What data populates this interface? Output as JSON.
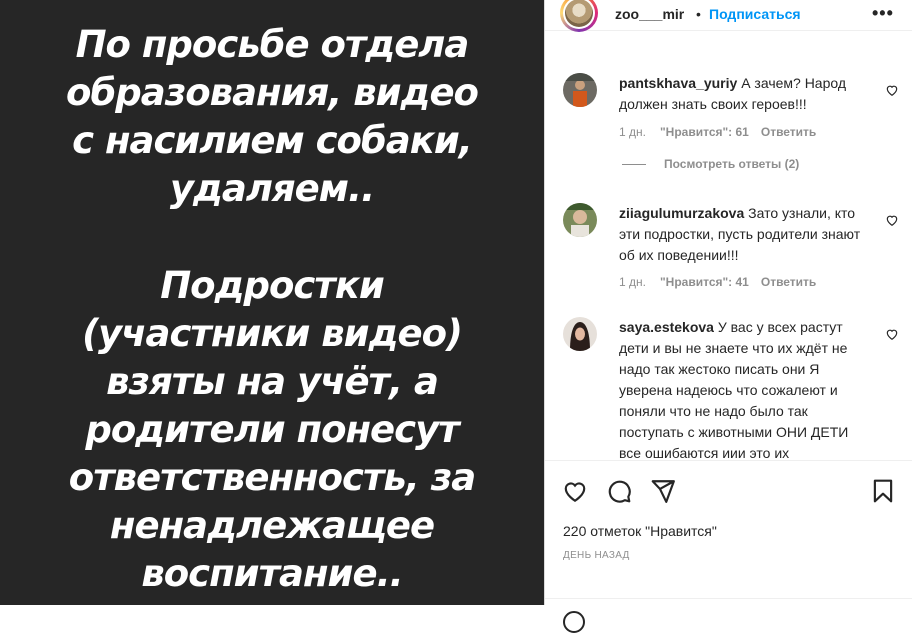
{
  "post_image": {
    "text_block_1": [
      "По просьбе отдела",
      "образования, видео",
      "с насилием собаки,",
      "удаляем.."
    ],
    "text_block_2": [
      "Подростки",
      "(участники видео)",
      "взяты на учёт, а",
      "родители понесут",
      "ответственность, за",
      "ненадлежащее",
      "воспитание.."
    ]
  },
  "header": {
    "username": "zoo___mir",
    "separator": "•",
    "follow_label": "Подписаться",
    "more_icon": "more-horizontal-icon"
  },
  "comments": [
    {
      "username": "pantskhava_yuriy",
      "text": "А зачем? Народ должен знать своих героев!!!",
      "time": "1 дн.",
      "likes": "\"Нравится\": 61",
      "reply": "Ответить"
    },
    {
      "username": "ziiagulumurzakova",
      "text": "Зато узнали, кто эти подростки, пусть родители знают об их поведении!!!",
      "time": "1 дн.",
      "likes": "\"Нравится\": 41",
      "reply": "Ответить"
    },
    {
      "username": "saya.estekova",
      "text": "У вас у всех растут дети и вы не знаете что их ждёт не надо так жестоко писать они Я уверена надеюсь что сожалеют и поняли что не надо было так поступать с животными ОНИ ДЕТИ все ошибаются иии это их"
    }
  ],
  "view_replies_label": "Посмотреть ответы (2)",
  "actions": {
    "like_icon": "heart-icon",
    "comment_icon": "comment-icon",
    "share_icon": "paper-plane-icon",
    "save_icon": "bookmark-icon"
  },
  "likes_count": "220 отметок \"Нравится\"",
  "post_time": "ДЕНЬ НАЗАД",
  "colors": {
    "follow_blue": "#0095f6",
    "image_bg": "#262626",
    "meta_gray": "#8e8e8e"
  }
}
